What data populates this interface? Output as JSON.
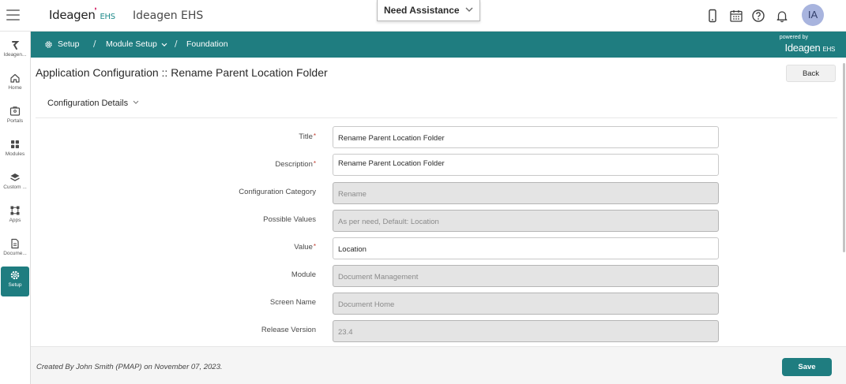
{
  "header": {
    "brand": "Ideagen",
    "brand_suffix": "EHS",
    "app_name": "Ideagen EHS",
    "assistance_label": "Need Assistance",
    "avatar_initials": "IA"
  },
  "sidebar": {
    "items": [
      {
        "label": "Ideagen...",
        "icon": "ideagen-logo-icon"
      },
      {
        "label": "Home",
        "icon": "home-icon"
      },
      {
        "label": "Portals",
        "icon": "portals-icon"
      },
      {
        "label": "Modules",
        "icon": "modules-grid-icon"
      },
      {
        "label": "Custom ...",
        "icon": "layers-icon"
      },
      {
        "label": "Apps",
        "icon": "apps-icon"
      },
      {
        "label": "Docume...",
        "icon": "document-icon"
      },
      {
        "label": "Setup",
        "icon": "gear-icon",
        "active": true
      }
    ]
  },
  "navbar": {
    "crumbs": [
      "Setup",
      "Module Setup",
      "Foundation"
    ],
    "powered_by": "powered by",
    "powered_brand": "Ideagen",
    "powered_suffix": "EHS"
  },
  "page": {
    "title": "Application Configuration :: Rename Parent Location Folder",
    "back_label": "Back",
    "section_title": "Configuration Details"
  },
  "form": {
    "fields": [
      {
        "label": "Title",
        "required": true,
        "value": "Rename Parent Location Folder",
        "readonly": false
      },
      {
        "label": "Description",
        "required": true,
        "value": "Rename Parent Location Folder",
        "readonly": false
      },
      {
        "label": "Configuration Category",
        "required": false,
        "value": "Rename",
        "readonly": true
      },
      {
        "label": "Possible Values",
        "required": false,
        "value": "As per need, Default: Location",
        "readonly": true
      },
      {
        "label": "Value",
        "required": true,
        "value": "Location",
        "readonly": false
      },
      {
        "label": "Module",
        "required": false,
        "value": "Document Management",
        "readonly": true
      },
      {
        "label": "Screen Name",
        "required": false,
        "value": "Document Home",
        "readonly": true
      },
      {
        "label": "Release Version",
        "required": false,
        "value": "23.4",
        "readonly": true
      }
    ]
  },
  "footer": {
    "created_text": "Created By John Smith (PMAP) on November 07, 2023.",
    "save_label": "Save"
  },
  "colors": {
    "teal": "#1f7d80",
    "required": "#c0392b",
    "readonly_bg": "#e4e4e4"
  }
}
